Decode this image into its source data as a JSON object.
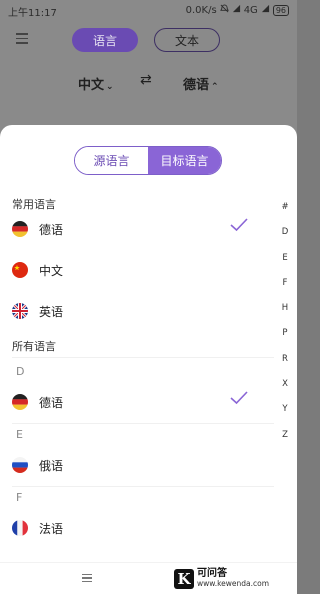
{
  "status": {
    "time": "上午11:17",
    "speed": "0.0K/s",
    "network": "4G",
    "battery": "96"
  },
  "header": {
    "mode_tab_active": "语言",
    "mode_tab_inactive": "文本",
    "source_lang": "中文",
    "target_lang": "德语",
    "swap_glyph": "⇄"
  },
  "sheet": {
    "segment": {
      "source": "源语言",
      "target": "目标语言"
    },
    "common_title": "常用语言",
    "common": [
      {
        "label": "德语",
        "flag": "germany-flag-icon",
        "selected": true
      },
      {
        "label": "中文",
        "flag": "china-flag-icon",
        "selected": false
      },
      {
        "label": "英语",
        "flag": "uk-flag-icon",
        "selected": false
      }
    ],
    "all_title": "所有语言",
    "groups": [
      {
        "letter": "D",
        "items": [
          {
            "label": "德语",
            "flag": "germany-flag-icon",
            "selected": true
          }
        ]
      },
      {
        "letter": "E",
        "items": [
          {
            "label": "俄语",
            "flag": "russia-flag-icon",
            "selected": false
          }
        ]
      },
      {
        "letter": "F",
        "items": [
          {
            "label": "法语",
            "flag": "france-flag-icon",
            "selected": false
          }
        ]
      }
    ],
    "alphabet": [
      "#",
      "D",
      "E",
      "F",
      "H",
      "P",
      "R",
      "X",
      "Y",
      "Z"
    ]
  },
  "watermark": {
    "logo": "K",
    "line1": "可问答",
    "line2": "www.kewenda.com"
  },
  "colors": {
    "accent": "#8a65d6",
    "accent_dark": "#6a4bb3",
    "check": "#8a65d6"
  }
}
